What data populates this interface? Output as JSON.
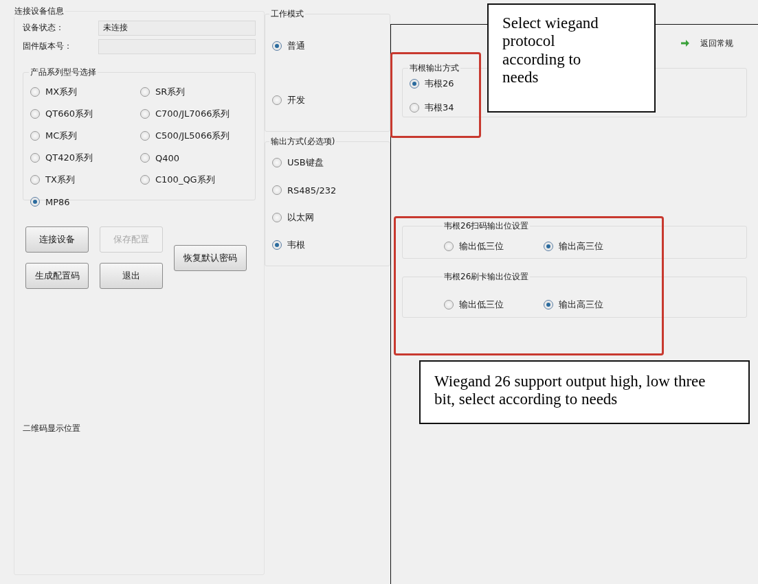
{
  "left_panel": {
    "title": "连接设备信息",
    "fields": [
      {
        "label": "设备状态：",
        "value": "未连接"
      },
      {
        "label": "固件版本号："
      }
    ],
    "product_series": {
      "title": "产品系列型号选择",
      "columns": [
        [
          {
            "label": "MX系列",
            "selected": false
          },
          {
            "label": "QT660系列",
            "selected": false
          },
          {
            "label": "MC系列",
            "selected": false
          },
          {
            "label": "QT420系列",
            "selected": false
          },
          {
            "label": "TX系列",
            "selected": false
          },
          {
            "label": "MP86",
            "selected": true
          }
        ],
        [
          {
            "label": "SR系列",
            "selected": false
          },
          {
            "label": "C700/JL7066系列",
            "selected": false
          },
          {
            "label": "C500/JL5066系列",
            "selected": false
          },
          {
            "label": "Q400",
            "selected": false
          },
          {
            "label": "C100_QG系列",
            "selected": false
          }
        ]
      ]
    },
    "buttons": [
      {
        "label": "连接设备",
        "disabled": false
      },
      {
        "label": "保存配置",
        "disabled": true
      },
      {
        "label": "恢复默认密码",
        "disabled": false
      },
      {
        "label": "生成配置码",
        "disabled": false
      },
      {
        "label": "退出",
        "disabled": false
      }
    ],
    "qr_label": "二维码显示位置"
  },
  "work_mode": {
    "title": "工作模式",
    "options": [
      {
        "label": "普通",
        "selected": true
      },
      {
        "label": "开发",
        "selected": false
      }
    ]
  },
  "output_mode": {
    "title": "输出方式(必选项)",
    "options": [
      {
        "label": "USB键盘",
        "selected": false
      },
      {
        "label": "RS485/232",
        "selected": false
      },
      {
        "label": "以太网",
        "selected": false
      },
      {
        "label": "韦根",
        "selected": true
      }
    ]
  },
  "right_panel": {
    "return_link": "返回常规",
    "wiegand_output": {
      "title": "韦根输出方式",
      "options": [
        {
          "label": "韦根26",
          "selected": true
        },
        {
          "label": "韦根34",
          "selected": false
        }
      ]
    },
    "bit_settings": [
      {
        "title": "韦根26扫码输出位设置",
        "options": [
          {
            "label": "输出低三位",
            "selected": false
          },
          {
            "label": "输出高三位",
            "selected": true
          }
        ]
      },
      {
        "title": "韦根26刷卡输出位设置",
        "options": [
          {
            "label": "输出低三位",
            "selected": false
          },
          {
            "label": "输出高三位",
            "selected": true
          }
        ]
      }
    ]
  },
  "annotations": [
    {
      "text": "Select wiegand protocol according to needs"
    },
    {
      "text": "Wiegand 26 support output high, low three bit, select according to needs"
    }
  ]
}
